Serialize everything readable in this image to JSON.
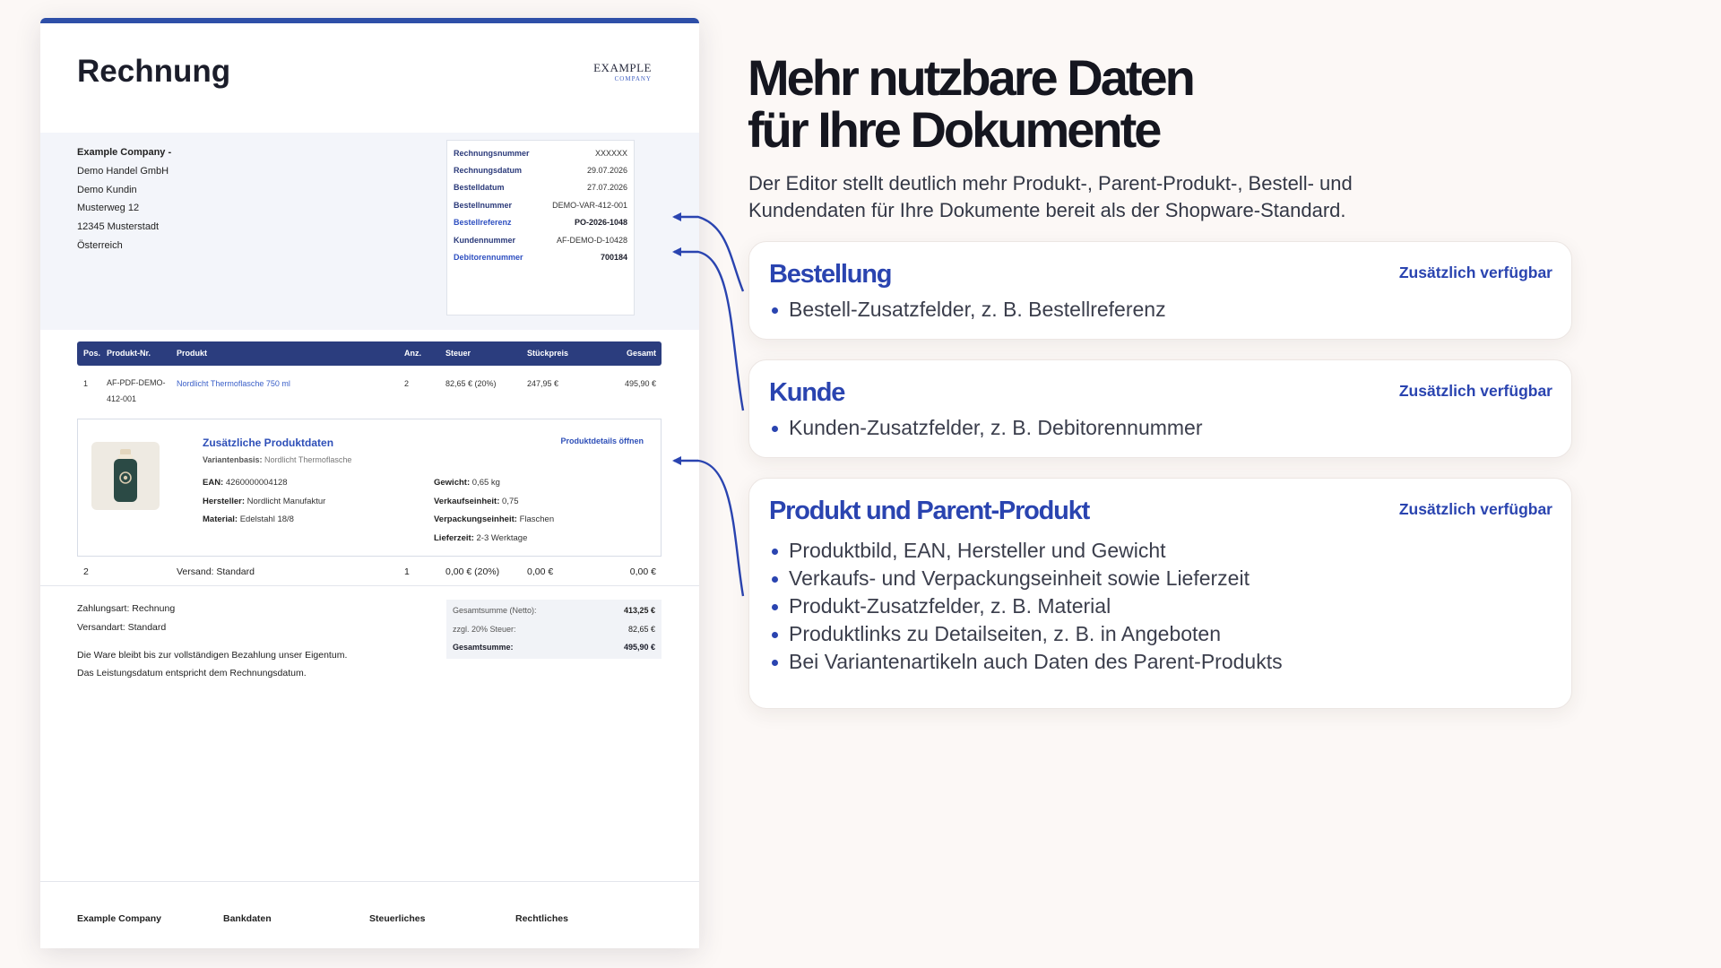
{
  "invoice": {
    "title": "Rechnung",
    "logo": {
      "line1": "EXAMPLE",
      "line2": "COMPANY"
    },
    "address": [
      "Example Company -",
      "Demo Handel GmbH",
      "Demo Kundin",
      "Musterweg 12",
      "12345 Musterstadt",
      "Österreich"
    ],
    "meta": [
      {
        "label": "Rechnungsnummer",
        "value": "XXXXXX",
        "highlight": false
      },
      {
        "label": "Rechnungsdatum",
        "value": "29.07.2026",
        "highlight": false
      },
      {
        "label": "Bestelldatum",
        "value": "27.07.2026",
        "highlight": false
      },
      {
        "label": "Bestellnummer",
        "value": "DEMO-VAR-412-001",
        "highlight": false
      },
      {
        "label": "Bestellreferenz",
        "value": "PO-2026-1048",
        "highlight": true
      },
      {
        "label": "Kundennummer",
        "value": "AF-DEMO-D-10428",
        "highlight": false
      },
      {
        "label": "Debitorennummer",
        "value": "700184",
        "highlight": true
      }
    ],
    "table_headers": {
      "pos": "Pos.",
      "product_no": "Produkt-Nr.",
      "product": "Produkt",
      "qty": "Anz.",
      "tax": "Steuer",
      "unit_price": "Stückpreis",
      "total": "Gesamt"
    },
    "line1": {
      "pos": "1",
      "product_no": "AF-PDF-DEMO-412-001",
      "product": "Nordlicht Thermoflasche 750 ml",
      "qty": "2",
      "tax": "82,65 € (20%)",
      "unit_price": "247,95 €",
      "total": "495,90 €"
    },
    "product_card": {
      "title": "Zusätzliche Produktdaten",
      "link": "Produktdetails öffnen",
      "base_label": "Variantenbasis:",
      "base_value": "Nordlicht Thermoflasche",
      "left": [
        {
          "label": "EAN:",
          "value": "4260000004128"
        },
        {
          "label": "Hersteller:",
          "value": "Nordlicht Manufaktur"
        },
        {
          "label": "Material:",
          "value": "Edelstahl 18/8"
        }
      ],
      "right": [
        {
          "label": "Gewicht:",
          "value": "0,65 kg"
        },
        {
          "label": "Verkaufseinheit:",
          "value": "0,75"
        },
        {
          "label": "Verpackungseinheit:",
          "value": "Flaschen"
        },
        {
          "label": "Lieferzeit:",
          "value": "2-3 Werktage"
        }
      ]
    },
    "line2": {
      "pos": "2",
      "description": "Versand: Standard",
      "qty": "1",
      "tax": "0,00 € (20%)",
      "unit_price": "0,00 €",
      "total": "0,00 €"
    },
    "payment": {
      "method": "Zahlungsart: Rechnung",
      "shipping": "Versandart: Standard",
      "note1": "Die Ware bleibt bis zur vollständigen Bezahlung unser Eigentum.",
      "note2": "Das Leistungsdatum entspricht dem Rechnungsdatum."
    },
    "totals": [
      {
        "label": "Gesamtsumme (Netto):",
        "value": "413,25 €"
      },
      {
        "label": "zzgl. 20% Steuer:",
        "value": "82,65 €"
      },
      {
        "label": "Gesamtsumme:",
        "value": "495,90 €"
      }
    ],
    "footer": [
      "Example Company",
      "Bankdaten",
      "Steuerliches",
      "Rechtliches"
    ]
  },
  "headline": {
    "line1": "Mehr nutzbare Daten",
    "line2": "für Ihre Dokumente"
  },
  "subline": "Der Editor stellt deutlich mehr Produkt-, Parent-Produkt-, Bestell- und Kundendaten für Ihre Dokumente bereit als der Shopware-Standard.",
  "cards": [
    {
      "title": "Bestellung",
      "badge": "Zusätzlich verfügbar",
      "items": [
        "Bestell-Zusatzfelder, z. B. Bestellreferenz"
      ]
    },
    {
      "title": "Kunde",
      "badge": "Zusätzlich verfügbar",
      "items": [
        "Kunden-Zusatzfelder, z. B. Debitorennummer"
      ]
    },
    {
      "title": "Produkt und Parent-Produkt",
      "badge": "Zusätzlich verfügbar",
      "items": [
        "Produktbild, EAN, Hersteller und Gewicht",
        "Verkaufs- und Verpackungseinheit sowie Lieferzeit",
        "Produkt-Zusatzfelder, z. B. Material",
        "Produktlinks zu Detailseiten, z. B. in Angeboten",
        "Bei Variantenartikeln auch Daten des Parent-Produkts"
      ]
    }
  ],
  "colors": {
    "accent": "#2a44b0",
    "table_header": "#2b3d7e",
    "background": "#fcf8f6"
  }
}
